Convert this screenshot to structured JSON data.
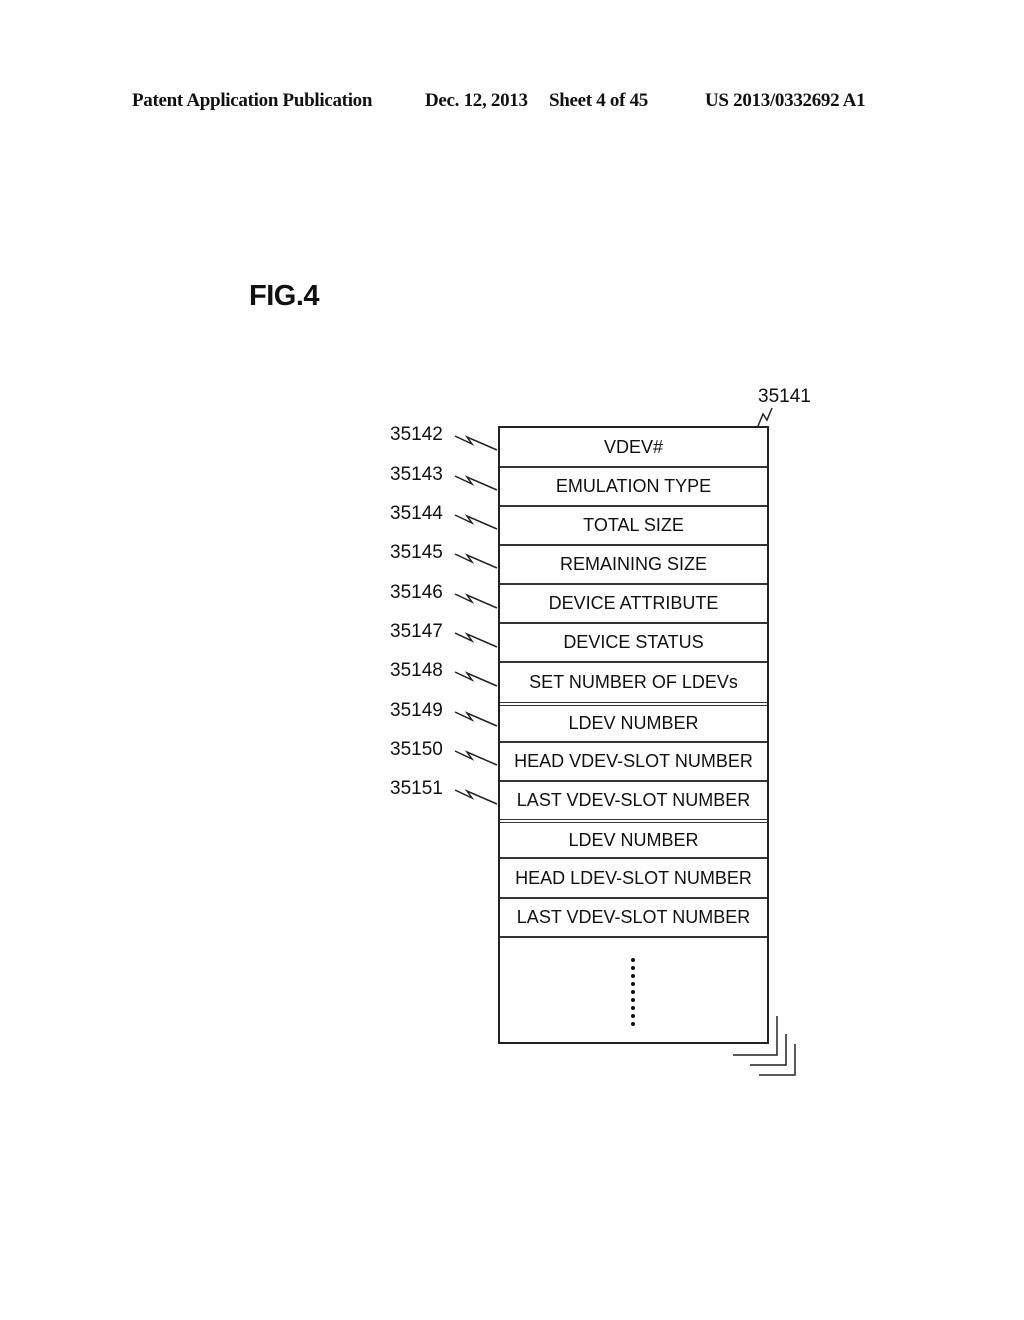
{
  "header": {
    "publication": "Patent Application Publication",
    "date": "Dec. 12, 2013",
    "sheet": "Sheet 4 of 45",
    "number": "US 2013/0332692 A1"
  },
  "figure": {
    "title": "FIG.4",
    "table_ref": "35141",
    "rows": [
      {
        "ref": "35142",
        "label": "VDEV#"
      },
      {
        "ref": "35143",
        "label": "EMULATION TYPE"
      },
      {
        "ref": "35144",
        "label": "TOTAL SIZE"
      },
      {
        "ref": "35145",
        "label": "REMAINING SIZE"
      },
      {
        "ref": "35146",
        "label": "DEVICE ATTRIBUTE"
      },
      {
        "ref": "35147",
        "label": "DEVICE STATUS"
      },
      {
        "ref": "35148",
        "label": "SET NUMBER OF LDEVs"
      },
      {
        "ref": "35149",
        "label": "LDEV NUMBER"
      },
      {
        "ref": "35150",
        "label": "HEAD VDEV-SLOT NUMBER"
      },
      {
        "ref": "35151",
        "label": "LAST VDEV-SLOT NUMBER"
      },
      {
        "ref": "",
        "label": "LDEV NUMBER"
      },
      {
        "ref": "",
        "label": "HEAD LDEV-SLOT NUMBER"
      },
      {
        "ref": "",
        "label": "LAST VDEV-SLOT NUMBER"
      }
    ],
    "continuation": "vertical-ellipsis"
  }
}
